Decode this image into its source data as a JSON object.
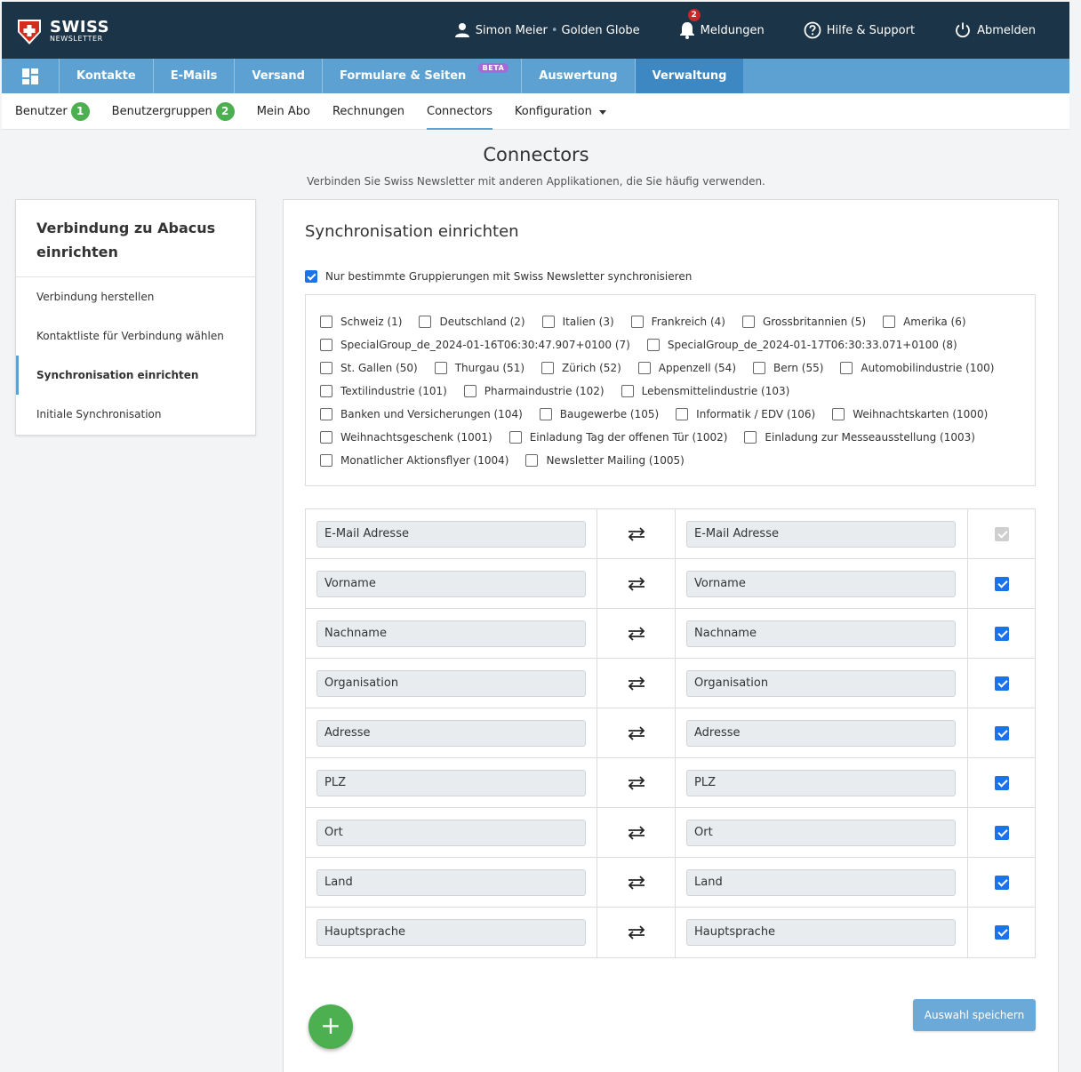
{
  "brand": {
    "line1": "SWISS",
    "line2": "NEWSLETTER",
    "shield_color": "#d52b1e"
  },
  "topbar": {
    "user_name": "Simon Meier",
    "separator": "•",
    "account": "Golden Globe",
    "notifications_label": "Meldungen",
    "notifications_count": "2",
    "help_label": "Hilfe & Support",
    "logout_label": "Abmelden"
  },
  "mainnav": {
    "items": [
      {
        "label": "Kontakte"
      },
      {
        "label": "E-Mails"
      },
      {
        "label": "Versand"
      },
      {
        "label": "Formulare & Seiten",
        "badge": "BETA"
      },
      {
        "label": "Auswertung"
      },
      {
        "label": "Verwaltung"
      }
    ]
  },
  "subnav": {
    "items": [
      {
        "label": "Benutzer",
        "count": "1"
      },
      {
        "label": "Benutzergruppen",
        "count": "2"
      },
      {
        "label": "Mein Abo"
      },
      {
        "label": "Rechnungen"
      },
      {
        "label": "Connectors"
      },
      {
        "label": "Konfiguration"
      }
    ]
  },
  "page": {
    "title": "Connectors",
    "subtitle": "Verbinden Sie Swiss Newsletter mit anderen Applikationen, die Sie häufig verwenden."
  },
  "left_panel": {
    "title": "Verbindung zu Abacus einrichten",
    "steps": [
      "Verbindung herstellen",
      "Kontaktliste für Verbindung wählen",
      "Synchronisation einrichten",
      "Initiale Synchronisation"
    ]
  },
  "sync": {
    "title": "Synchronisation einrichten",
    "only_groups_label": "Nur bestimmte Gruppierungen mit Swiss Newsletter synchronisieren",
    "groups": [
      [
        "Schweiz (1)",
        "Deutschland (2)",
        "Italien (3)",
        "Frankreich (4)",
        "Grossbritannien (5)",
        "Amerika (6)"
      ],
      [
        "SpecialGroup_de_2024-01-16T06:30:47.907+0100 (7)",
        "SpecialGroup_de_2024-01-17T06:30:33.071+0100 (8)"
      ],
      [
        "St. Gallen (50)",
        "Thurgau (51)",
        "Zürich (52)",
        "Appenzell (54)",
        "Bern (55)",
        "Automobilindustrie (100)"
      ],
      [
        "Textilindustrie (101)",
        "Pharmaindustrie (102)",
        "Lebensmittelindustrie (103)"
      ],
      [
        "Banken und Versicherungen (104)",
        "Baugewerbe (105)",
        "Informatik / EDV (106)",
        "Weihnachtskarten (1000)"
      ],
      [
        "Weihnachtsgeschenk (1001)",
        "Einladung Tag der offenen Tür (1002)",
        "Einladung zur Messeausstellung (1003)"
      ],
      [
        "Monatlicher Aktionsflyer (1004)",
        "Newsletter Mailing (1005)"
      ]
    ],
    "mappings": [
      {
        "left": "E-Mail Adresse",
        "right": "E-Mail Adresse"
      },
      {
        "left": "Vorname",
        "right": "Vorname"
      },
      {
        "left": "Nachname",
        "right": "Nachname"
      },
      {
        "left": "Organisation",
        "right": "Organisation"
      },
      {
        "left": "Adresse",
        "right": "Adresse"
      },
      {
        "left": "PLZ",
        "right": "PLZ"
      },
      {
        "left": "Ort",
        "right": "Ort"
      },
      {
        "left": "Land",
        "right": "Land"
      },
      {
        "left": "Hauptsprache",
        "right": "Hauptsprache"
      }
    ],
    "add_label": "+",
    "save_label": "Auswahl speichern"
  }
}
